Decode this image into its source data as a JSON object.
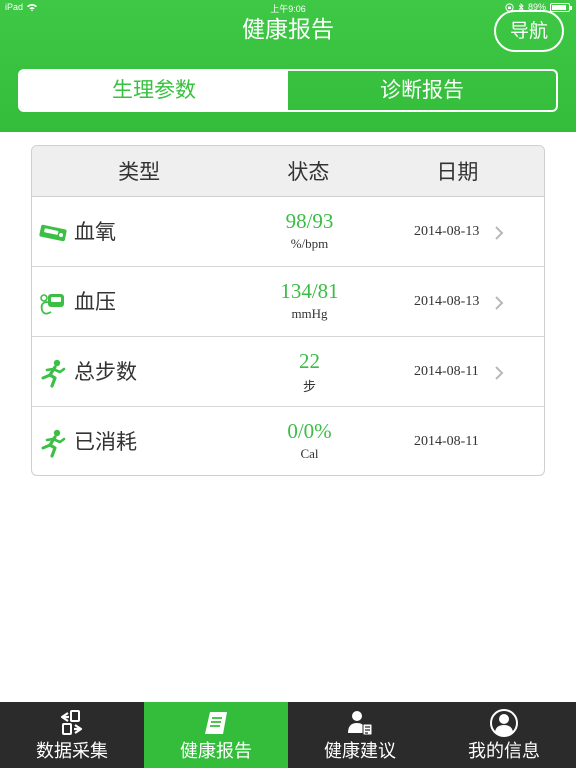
{
  "status_bar": {
    "device": "iPad",
    "time": "上午9:06",
    "battery": "89%",
    "battery_level": 0.89
  },
  "header": {
    "title": "健康报告",
    "nav_button": "导航"
  },
  "segments": {
    "tabs": [
      {
        "label": "生理参数",
        "active": true
      },
      {
        "label": "诊断报告",
        "active": false
      }
    ]
  },
  "table": {
    "headers": [
      "类型",
      "状态",
      "日期"
    ],
    "rows": [
      {
        "name": "血氧",
        "icon": "oximeter-icon",
        "value": "98/93",
        "unit": "%/bpm",
        "date": "2014-08-13",
        "chevron": true
      },
      {
        "name": "血压",
        "icon": "blood-pressure-icon",
        "value": "134/81",
        "unit": "mmHg",
        "date": "2014-08-13",
        "chevron": true
      },
      {
        "name": "总步数",
        "icon": "runner-icon",
        "value": "22",
        "unit": "步",
        "date": "2014-08-11",
        "chevron": true
      },
      {
        "name": "已消耗",
        "icon": "runner-icon",
        "value": "0/0%",
        "unit": "Cal",
        "date": "2014-08-11",
        "chevron": false
      }
    ]
  },
  "tabbar": {
    "items": [
      {
        "label": "数据采集",
        "icon": "data-collect-icon",
        "active": false
      },
      {
        "label": "健康报告",
        "icon": "report-icon",
        "active": true
      },
      {
        "label": "健康建议",
        "icon": "advice-icon",
        "active": false
      },
      {
        "label": "我的信息",
        "icon": "profile-icon",
        "active": false
      }
    ]
  },
  "colors": {
    "brand_green": "#37c13f",
    "tabbar_dark": "#2b2b2b",
    "value_green": "#3bbd45"
  }
}
